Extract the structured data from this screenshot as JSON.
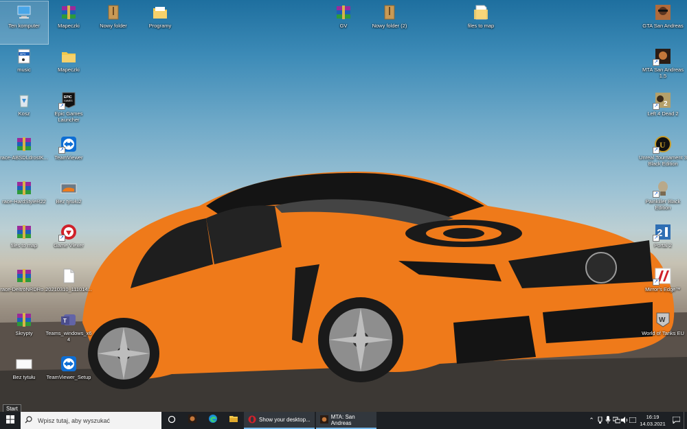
{
  "desktop": {
    "icons_left": [
      {
        "label": "Ten komputer",
        "icon": "computer-icon"
      },
      {
        "label": "Mapeczki",
        "icon": "winrar-archive-icon"
      },
      {
        "label": "Nowy folder",
        "icon": "folder-archive-icon"
      },
      {
        "label": "Programy",
        "icon": "folder-icon"
      },
      {
        "label": "music",
        "icon": "mp3-file-icon"
      },
      {
        "label": "Mapeczki",
        "icon": "folder-icon"
      },
      {
        "label": "Kosz",
        "icon": "recycle-bin-icon"
      },
      {
        "label": "Epic Games Launcher",
        "icon": "epic-games-icon"
      },
      {
        "label": "race-ABSDLdrostK...",
        "icon": "winrar-archive-icon"
      },
      {
        "label": "TeamViewer",
        "icon": "teamviewer-icon"
      },
      {
        "label": "race-HardStyleR22",
        "icon": "winrar-archive-icon"
      },
      {
        "label": "Bez tytułu2",
        "icon": "image-file-icon"
      },
      {
        "label": "files to map",
        "icon": "winrar-archive-icon"
      },
      {
        "label": "Game Vlexer",
        "icon": "game-app-icon"
      },
      {
        "label": "race-DeltroNRDRo...",
        "icon": "winrar-archive-icon"
      },
      {
        "label": "20210310_111014...",
        "icon": "blank-file-icon"
      },
      {
        "label": "Skrypty",
        "icon": "winrar-archive-icon"
      },
      {
        "label": "Teams_windows_x64",
        "icon": "teams-icon"
      },
      {
        "label": "Bez tytułu",
        "icon": "image-file-icon"
      },
      {
        "label": "TeamViewer_Setup",
        "icon": "teamviewer-icon"
      }
    ],
    "icons_top_middle": [
      {
        "label": "GV",
        "icon": "winrar-archive-icon"
      },
      {
        "label": "Nowy folder (2)",
        "icon": "folder-archive-icon"
      },
      {
        "label": "files to map",
        "icon": "folder-icon"
      }
    ],
    "icons_right": [
      {
        "label": "GTA San Andreas",
        "icon": "gta-sa-icon"
      },
      {
        "label": "MTA San Andreas 1.5",
        "icon": "mta-sa-icon"
      },
      {
        "label": "Left 4 Dead 2",
        "icon": "left4dead2-icon"
      },
      {
        "label": "Unreal Tournament 3 Black Edition",
        "icon": "unreal-tournament-icon"
      },
      {
        "label": "Painkiller Black Edition",
        "icon": "painkiller-icon"
      },
      {
        "label": "Portal 2",
        "icon": "portal2-icon"
      },
      {
        "label": "Mirror's Edge™",
        "icon": "mirrors-edge-icon"
      },
      {
        "label": "World of Tanks EU",
        "icon": "world-of-tanks-icon"
      }
    ]
  },
  "taskbar": {
    "search_placeholder": "Wpisz tutaj, aby wyszukać",
    "start_tooltip": "Start",
    "apps": [
      {
        "label": "Show your desktop...",
        "icon": "opera-icon"
      },
      {
        "label": "MTA: San Andreas",
        "icon": "mta-sa-icon"
      }
    ],
    "clock_time": "16:19",
    "clock_date": "14.03.2021"
  },
  "colors": {
    "taskbar_bg": "#1d2024",
    "active_underline": "#76b9ed",
    "car_orange": "#f07a1c"
  }
}
